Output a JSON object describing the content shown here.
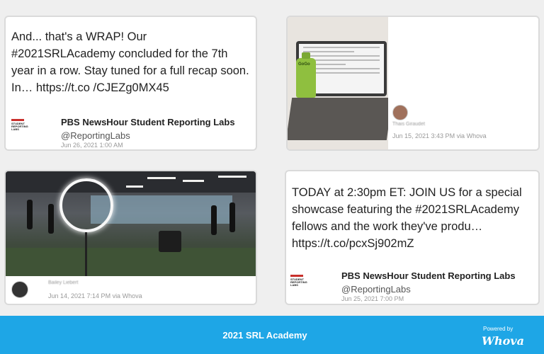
{
  "posts": [
    {
      "text": "And... that's a WRAP! Our #2021SRLAcademy concluded for the 7th year in a row. Stay tuned for a full recap soon. In… https://t.co /CJEZg0MX45",
      "author": "PBS NewsHour Student Reporting Labs",
      "handle": "@ReportingLabs",
      "date": "Jun 26, 2021 1:00 AM",
      "logo_text": "STUDENT REPORTING LABS"
    },
    {
      "name": "Thais Giraudet",
      "date": "Jun 15, 2021 3:43 PM via Whova",
      "pouch_label": "GoGo"
    },
    {
      "name": "Bailey Liebert",
      "date": "Jun 14, 2021 7:14 PM via Whova"
    },
    {
      "text": "TODAY at 2:30pm ET: JOIN US for a special showcase featuring the #2021SRLAcademy fellows and the work they've produ… https://t.co/pcxSj902mZ",
      "author": "PBS NewsHour Student Reporting Labs",
      "handle": "@ReportingLabs",
      "date": "Jun 25, 2021 7:00 PM",
      "logo_text": "STUDENT REPORTING LABS"
    }
  ],
  "footer": {
    "title": "2021 SRL Academy",
    "powered_by": "Powered by",
    "brand": "Whova"
  }
}
